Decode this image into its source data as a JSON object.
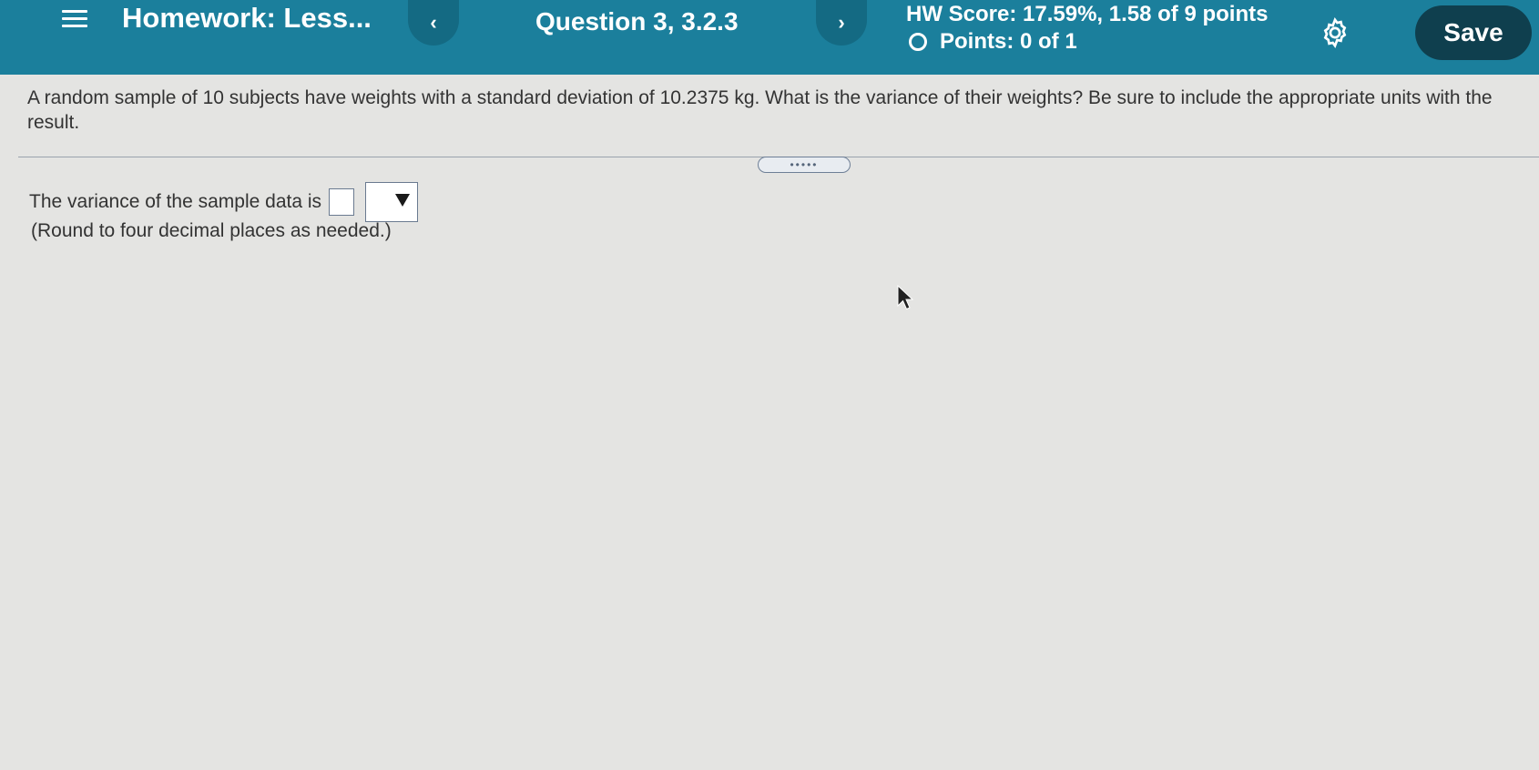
{
  "header": {
    "title": "Homework: Less...",
    "question": "Question 3, 3.2.3",
    "prev_label": "‹",
    "next_label": "›",
    "score": "HW Score: 17.59%, 1.58 of 9 points",
    "points": "Points: 0 of 1",
    "save_label": "Save",
    "colors": {
      "bar": "#1b7f9c",
      "save": "#0f3f4e"
    }
  },
  "question": {
    "text": "A random sample of 10 subjects have weights with a standard deviation of 10.2375 kg. What is the variance of their weights? Be sure to include the appropriate units with the result."
  },
  "answer": {
    "prompt": "The variance of the sample data is",
    "input_value": "",
    "unit_selected": "",
    "note": "(Round to four decimal places as needed.)"
  },
  "icons": [
    "menu-icon",
    "prev-arrow-icon",
    "next-arrow-icon",
    "circle-icon",
    "gear-icon",
    "dropdown-caret-icon",
    "mouse-cursor-icon"
  ]
}
